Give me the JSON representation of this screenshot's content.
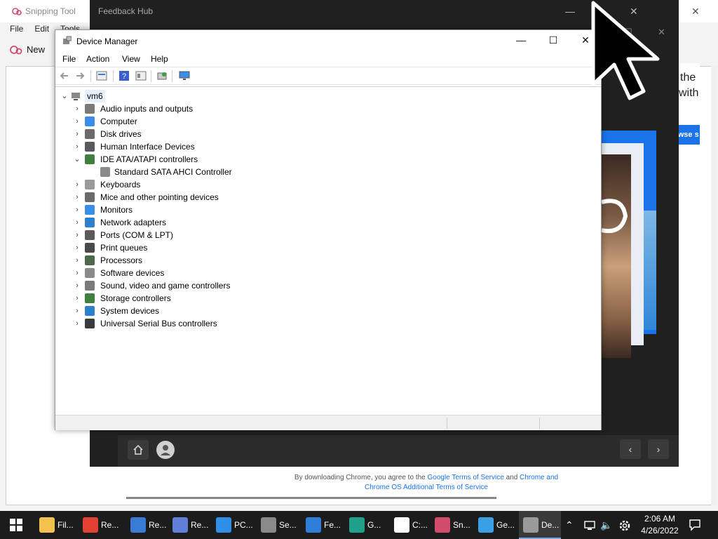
{
  "snipping_tool": {
    "title": "Snipping Tool",
    "menu": [
      "File",
      "Edit",
      "Tools"
    ],
    "new_label": "New"
  },
  "feedback_hub": {
    "title": "Feedback Hub"
  },
  "chrome_page": {
    "footer_pre": "By downloading Chrome, you agree to the",
    "footer_link1": "Google Terms of Service",
    "footer_and": "and",
    "footer_link2": "Chrome and",
    "footer_link3": "Chrome OS Additional Terms of Service",
    "promo_line1": "the",
    "promo_line2": "with",
    "promo_button": "owse s"
  },
  "device_manager": {
    "title": "Device Manager",
    "menu": [
      "File",
      "Action",
      "View",
      "Help"
    ],
    "root": "vm6",
    "categories": [
      {
        "label": "Audio inputs and outputs",
        "expanded": false,
        "color": "#7a7a7a"
      },
      {
        "label": "Computer",
        "expanded": false,
        "color": "#3a8ee6"
      },
      {
        "label": "Disk drives",
        "expanded": false,
        "color": "#6a6a6a"
      },
      {
        "label": "Human Interface Devices",
        "expanded": false,
        "color": "#5a5a5a"
      },
      {
        "label": "IDE ATA/ATAPI controllers",
        "expanded": true,
        "color": "#3f7f3f"
      },
      {
        "label": "Standard SATA AHCI Controller",
        "child": true,
        "color": "#8a8a8a"
      },
      {
        "label": "Keyboards",
        "expanded": false,
        "color": "#9a9a9a"
      },
      {
        "label": "Mice and other pointing devices",
        "expanded": false,
        "color": "#6a6a6a"
      },
      {
        "label": "Monitors",
        "expanded": false,
        "color": "#3a8ee6"
      },
      {
        "label": "Network adapters",
        "expanded": false,
        "color": "#2f7fcf"
      },
      {
        "label": "Ports (COM & LPT)",
        "expanded": false,
        "color": "#5a5a5a"
      },
      {
        "label": "Print queues",
        "expanded": false,
        "color": "#4a4a4a"
      },
      {
        "label": "Processors",
        "expanded": false,
        "color": "#4a6a4a"
      },
      {
        "label": "Software devices",
        "expanded": false,
        "color": "#8a8a8a"
      },
      {
        "label": "Sound, video and game controllers",
        "expanded": false,
        "color": "#7a7a7a"
      },
      {
        "label": "Storage controllers",
        "expanded": false,
        "color": "#3f7f3f"
      },
      {
        "label": "System devices",
        "expanded": false,
        "color": "#2f7fcf"
      },
      {
        "label": "Universal Serial Bus controllers",
        "expanded": false,
        "color": "#3a3a3a"
      }
    ]
  },
  "taskbar": {
    "items": [
      {
        "label": "Fil...",
        "icon": "file-explorer-icon",
        "color": "#f2c14e"
      },
      {
        "label": "Re...",
        "icon": "chrome-icon",
        "color": "#e34133"
      },
      {
        "label": "Re...",
        "icon": "registry-icon",
        "color": "#3a7bd5"
      },
      {
        "label": "Re...",
        "icon": "remote-desktop-icon",
        "color": "#5f7fd8"
      },
      {
        "label": "PC...",
        "icon": "pc-health-icon",
        "color": "#2f8fe6"
      },
      {
        "label": "Se...",
        "icon": "settings-icon",
        "color": "#8a8a8a"
      },
      {
        "label": "Fe...",
        "icon": "feedback-hub-icon",
        "color": "#2f7fd8"
      },
      {
        "label": "G...",
        "icon": "edge-icon",
        "color": "#1fa08a"
      },
      {
        "label": "C:...",
        "icon": "7zip-icon",
        "color": "#ffffff"
      },
      {
        "label": "Sn...",
        "icon": "snipping-tool-icon",
        "color": "#d04c6a"
      },
      {
        "label": "Ge...",
        "icon": "get-started-icon",
        "color": "#3aa0e6"
      },
      {
        "label": "De...",
        "icon": "device-manager-icon",
        "color": "#9a9a9a",
        "active": true
      }
    ],
    "time": "2:06 AM",
    "date": "4/26/2022"
  }
}
